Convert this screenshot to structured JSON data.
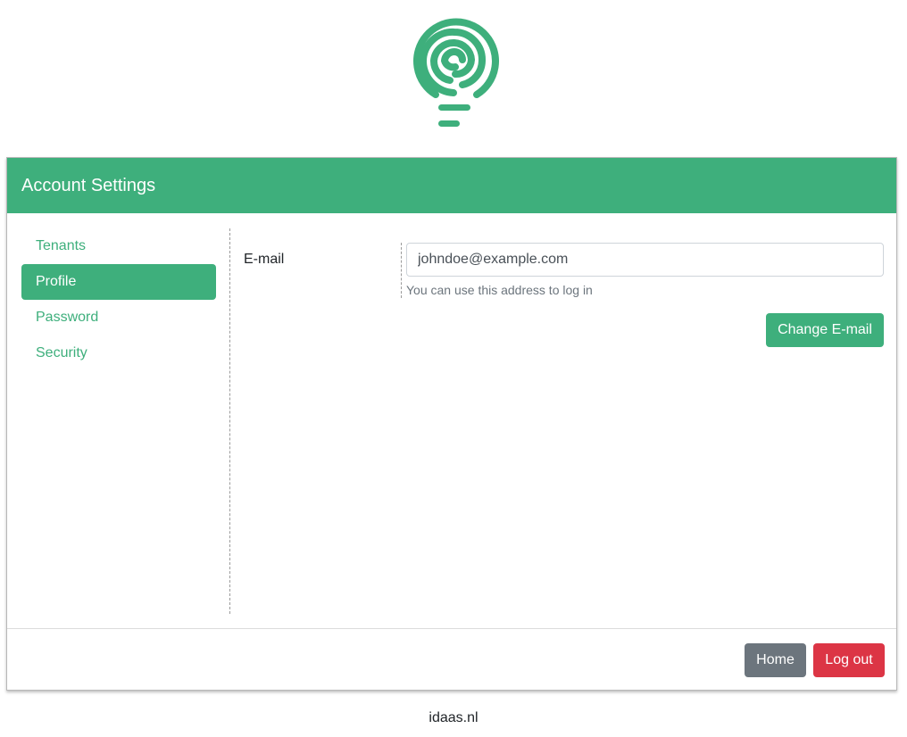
{
  "brand": {
    "logo_icon": "lightbulb-spiral-icon",
    "accent_color": "#3eaf7c"
  },
  "card": {
    "title": "Account Settings"
  },
  "sidebar": {
    "items": [
      {
        "label": "Tenants",
        "active": false
      },
      {
        "label": "Profile",
        "active": true
      },
      {
        "label": "Password",
        "active": false
      },
      {
        "label": "Security",
        "active": false
      }
    ]
  },
  "profile": {
    "email_label": "E-mail",
    "email_value": "johndoe@example.com",
    "email_help": "You can use this address to log in",
    "change_email_button": "Change E-mail"
  },
  "footer_actions": {
    "home_button": "Home",
    "logout_button": "Log out"
  },
  "footer": {
    "domain": "idaas.nl"
  }
}
